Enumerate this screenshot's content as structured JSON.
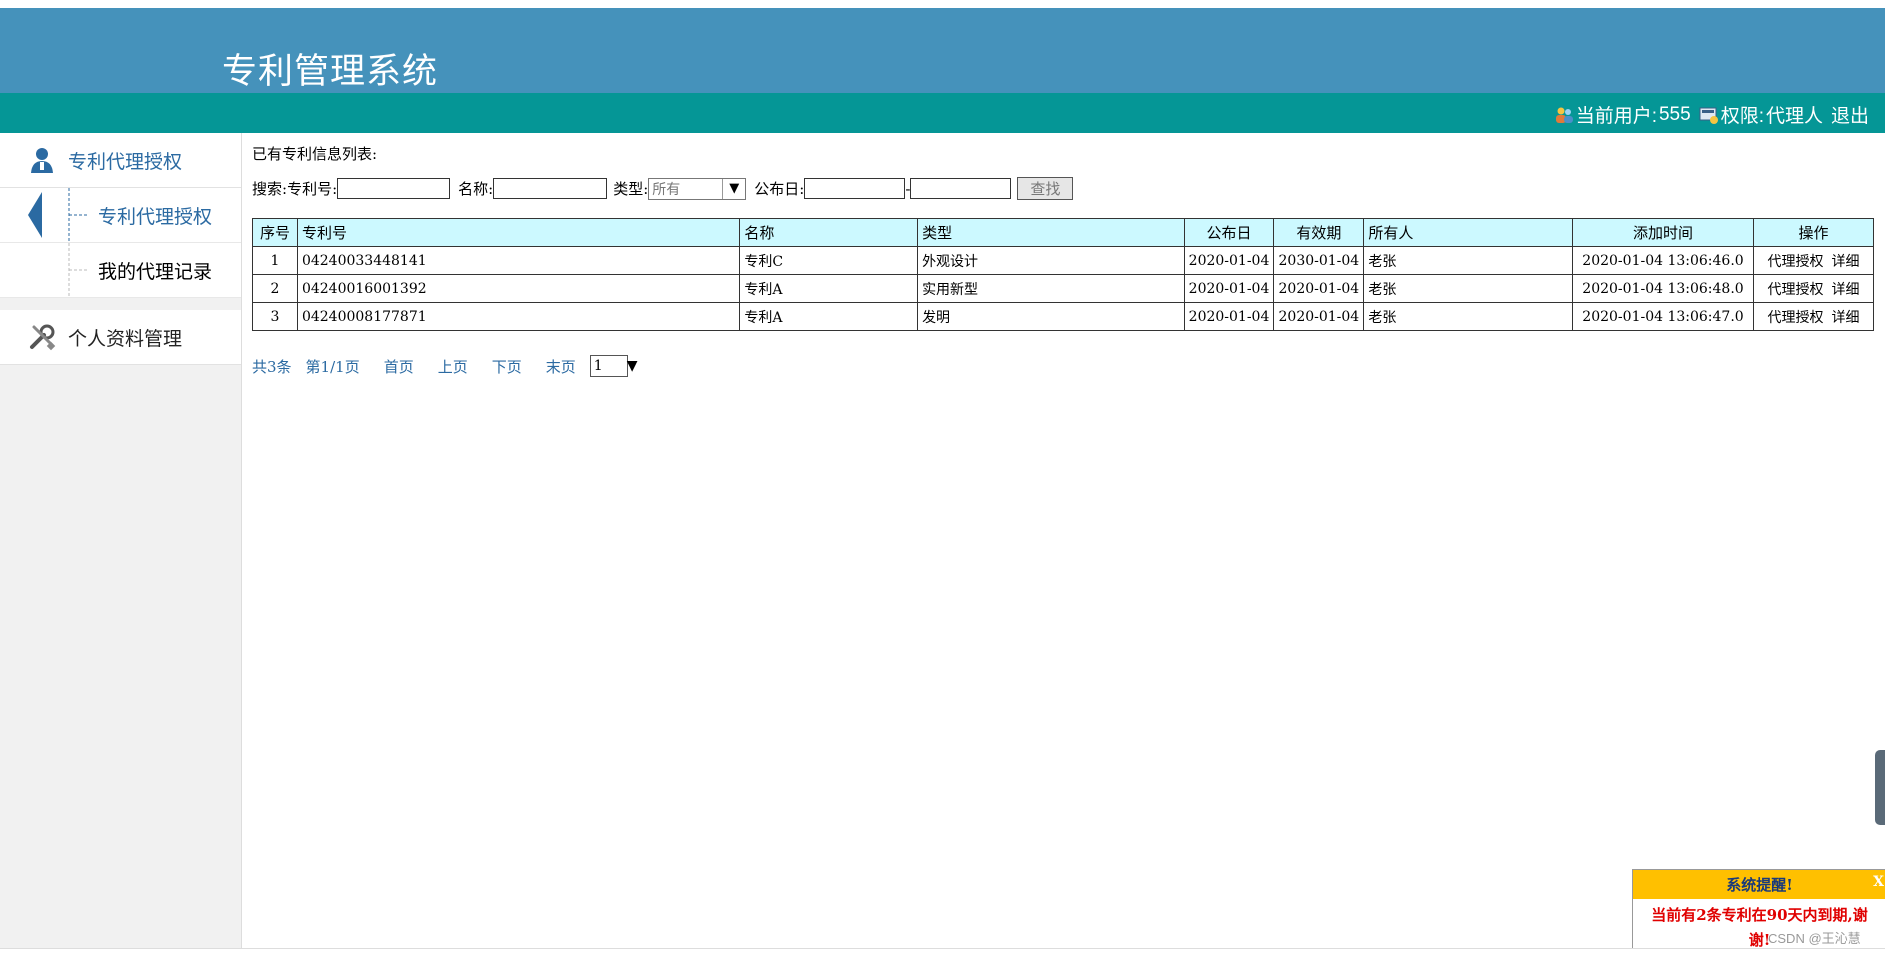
{
  "header": {
    "title": "专利管理系统",
    "user_label": "当前用户:",
    "user_name": "555",
    "role_label": "权限:",
    "role_value": "代理人",
    "logout": "退出"
  },
  "sidebar": {
    "groups": [
      {
        "label": "专利代理授权",
        "icon": "user-icon",
        "items": [
          {
            "label": "专利代理授权",
            "active": true
          },
          {
            "label": "我的代理记录",
            "active": false
          }
        ]
      },
      {
        "label": "个人资料管理",
        "icon": "tools-icon",
        "items": []
      }
    ]
  },
  "main": {
    "caption": "已有专利信息列表:",
    "search": {
      "label": "搜索:",
      "number_label": "专利号:",
      "number_value": "",
      "name_label": "名称:",
      "name_value": "",
      "type_label": "类型:",
      "type_selected": "所有",
      "date_label": "公布日:",
      "date_from": "",
      "date_sep": "-",
      "date_to": "",
      "button": "查找"
    },
    "table": {
      "headers": [
        "序号",
        "专利号",
        "名称",
        "类型",
        "公布日",
        "有效期",
        "所有人",
        "添加时间",
        "操作"
      ],
      "rows": [
        {
          "no": "1",
          "number": "04240033448141",
          "name": "专利C",
          "type": "外观设计",
          "pub": "2020-01-04",
          "valid": "2030-01-04",
          "owner": "老张",
          "added": "2020-01-04 13:06:46.0",
          "op1": "代理授权",
          "op2": "详细"
        },
        {
          "no": "2",
          "number": "04240016001392",
          "name": "专利A",
          "type": "实用新型",
          "pub": "2020-01-04",
          "valid": "2020-01-04",
          "owner": "老张",
          "added": "2020-01-04 13:06:48.0",
          "op1": "代理授权",
          "op2": "详细"
        },
        {
          "no": "3",
          "number": "04240008177871",
          "name": "专利A",
          "type": "发明",
          "pub": "2020-01-04",
          "valid": "2020-01-04",
          "owner": "老张",
          "added": "2020-01-04 13:06:47.0",
          "op1": "代理授权",
          "op2": "详细"
        }
      ]
    },
    "pager": {
      "total": "共3条",
      "page": "第1/1页",
      "first": "首页",
      "prev": "上页",
      "next": "下页",
      "last": "末页",
      "selected": "1"
    }
  },
  "popup": {
    "title": "系统提醒!",
    "close": "X",
    "message": "当前有2条专利在90天内到期,谢谢!"
  },
  "watermark": "CSDN @王沁慧",
  "colors": {
    "header_bg": "#4592bb",
    "userbar_bg": "#059696",
    "table_header_bg": "#ccf9ff",
    "link": "#2b6aa2",
    "popup_title_bg": "#ffc000",
    "popup_text": "#e00000"
  }
}
